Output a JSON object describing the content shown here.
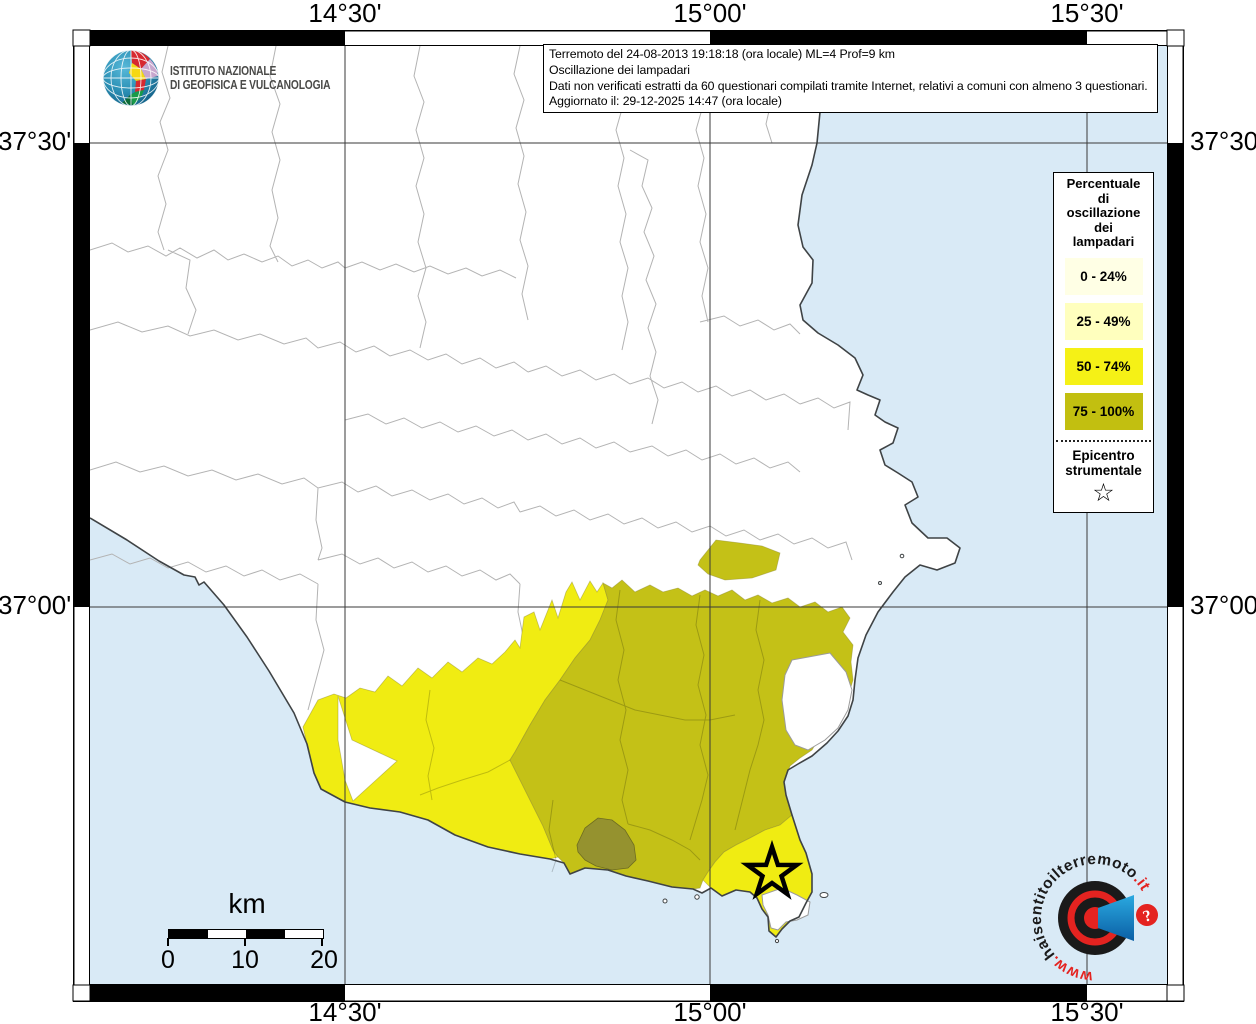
{
  "axes": {
    "meridians": [
      "14°30'",
      "15°00'",
      "15°30'"
    ],
    "parallels": [
      "37°30'",
      "37°00'"
    ]
  },
  "branding": {
    "institute_line1": "ISTITUTO NAZIONALE",
    "institute_line2": "DI GEOFISICA E VULCANOLOGIA"
  },
  "info_box": {
    "line1": "Terremoto del 24-08-2013 19:18:18 (ora locale) ML=4 Prof=9 km",
    "line2": "Oscillazione dei lampadari",
    "line3": "Dati non verificati estratti da 60 questionari compilati tramite Internet, relativi a comuni con almeno 3 questionari.",
    "line4": "Aggiornato il: 29-12-2025 14:47 (ora locale)"
  },
  "legend": {
    "title_lines": [
      "Percentuale",
      "di",
      "oscillazione",
      "dei",
      "lampadari"
    ],
    "classes": [
      {
        "label": "0 - 24%",
        "color": "#FFFFE5"
      },
      {
        "label": "25 - 49%",
        "color": "#FFFFBE"
      },
      {
        "label": "50 - 74%",
        "color": "#F5F116"
      },
      {
        "label": "75 - 100%",
        "color": "#C2BF10"
      }
    ],
    "epicenter_line1": "Epicentro",
    "epicenter_line2": "strumentale",
    "star_glyph": "☆"
  },
  "scale_bar": {
    "unit": "km",
    "tick_labels": [
      "0",
      "10",
      "20"
    ]
  },
  "watermark": {
    "prefix": "www.",
    "middle": "haisentitoilterremoto",
    "suffix": ".it",
    "badge": "?"
  },
  "map_colors": {
    "sea": "#D9EAF6",
    "land": "#FFFFFF",
    "coast": "#3F4345",
    "boundary": "#B3B3B3",
    "grid": "#3A3A3A",
    "class3_fill": "#F0EC12",
    "class4_fill": "#C4C117",
    "dark_region_fill": "#95922F"
  }
}
